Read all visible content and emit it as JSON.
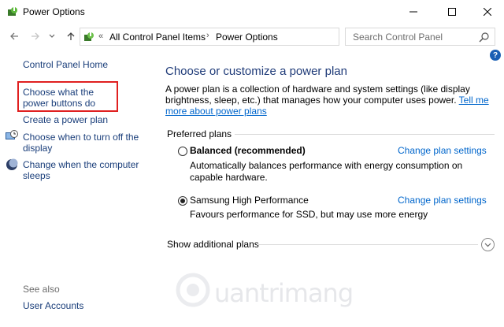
{
  "window": {
    "title": "Power Options",
    "controls": {
      "minimize": "minimize-icon",
      "maximize": "maximize-icon",
      "close": "close-icon"
    }
  },
  "address": {
    "breadcrumbs": [
      "All Control Panel Items",
      "Power Options"
    ],
    "chevron": "«",
    "separator": "›"
  },
  "search": {
    "placeholder": "Search Control Panel"
  },
  "sidebar": {
    "home": "Control Panel Home",
    "items": [
      {
        "label": "Choose what the power buttons do",
        "highlighted": true
      },
      {
        "label": "Create a power plan"
      },
      {
        "label": "Choose when to turn off the display",
        "icon": "monitor-clock-icon"
      },
      {
        "label": "Change when the computer sleeps",
        "icon": "moon-icon"
      }
    ],
    "see_also": "See also",
    "see_also_items": [
      {
        "label": "User Accounts"
      }
    ]
  },
  "main": {
    "title": "Choose or customize a power plan",
    "intro": "A power plan is a collection of hardware and system settings (like display brightness, sleep, etc.) that manages how your computer uses power.",
    "intro_link": "Tell me more about power plans",
    "preferred_label": "Preferred plans",
    "plans": [
      {
        "name": "Balanced (recommended)",
        "description": "Automatically balances performance with energy consumption on capable hardware.",
        "selected": false,
        "change_link": "Change plan settings"
      },
      {
        "name": "Samsung High Performance",
        "description": "Favours performance for SSD, but may use more energy",
        "selected": true,
        "change_link": "Change plan settings"
      }
    ],
    "additional_plans": "Show additional plans"
  },
  "help": {
    "label": "?"
  },
  "colors": {
    "link": "#1a3e7a",
    "accent_link": "#0066cc",
    "heading": "#1e3a78",
    "highlight_box": "#e02020"
  }
}
